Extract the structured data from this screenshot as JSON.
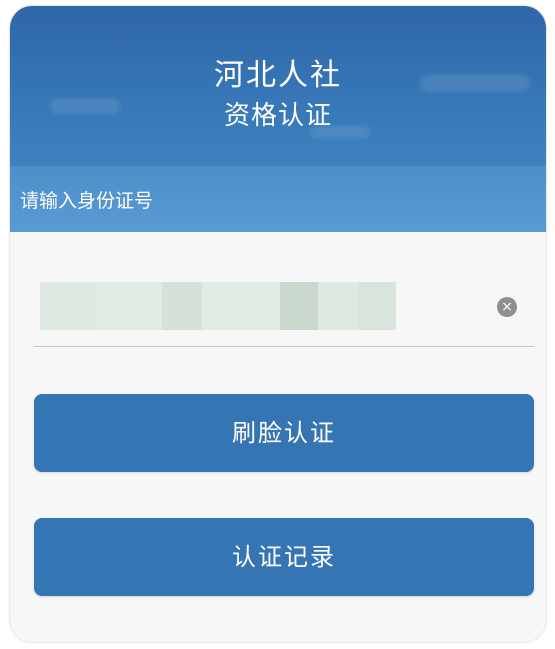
{
  "header": {
    "title": "河北人社",
    "subtitle": "资格认证"
  },
  "prompt": {
    "label": "请输入身份证号"
  },
  "id_input": {
    "value": "",
    "clear_icon": "clear-circle-icon"
  },
  "actions": {
    "face_auth_label": "刷脸认证",
    "records_label": "认证记录"
  },
  "colors": {
    "header": "#3676b6",
    "prompt_bar": "#5a9ad4",
    "button": "#3575b4"
  }
}
